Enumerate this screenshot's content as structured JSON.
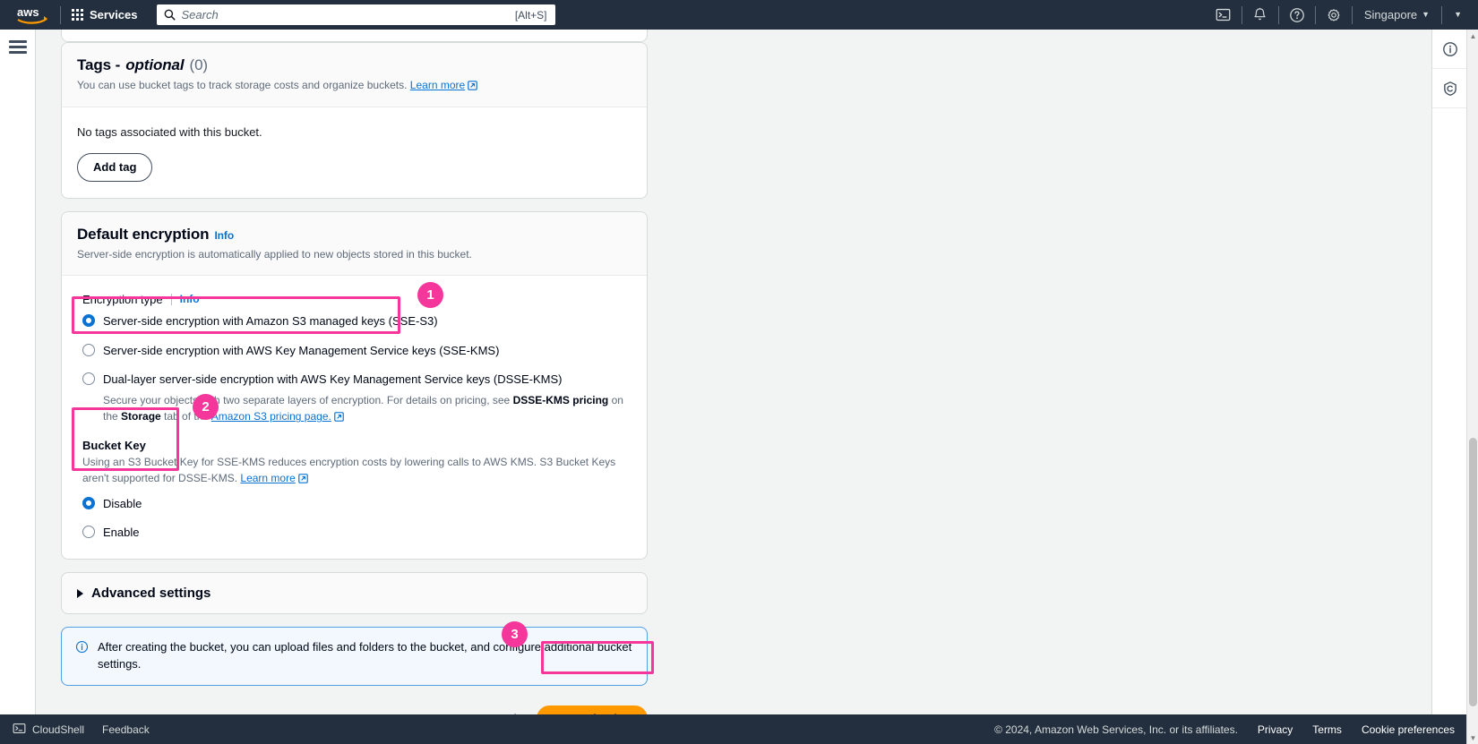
{
  "topnav": {
    "logo_icon": "aws-logo",
    "services_label": "Services",
    "services_icon": "grid-icon",
    "search": {
      "icon": "search-icon",
      "placeholder": "Search",
      "shortcut": "[Alt+S]",
      "value": ""
    },
    "icons": {
      "cloudshell": "terminal-icon",
      "notifications": "bell-icon",
      "help": "question-circle-icon",
      "settings": "gear-icon",
      "account_caret": "caret-down-icon"
    },
    "region_label": "Singapore",
    "region_caret": "▼"
  },
  "leftrail": {
    "menu_icon": "hamburger-menu-icon"
  },
  "rightrail": {
    "items": [
      {
        "icon": "info-circle-icon",
        "name": "help-panel-toggle"
      },
      {
        "icon": "shield-privacy-icon",
        "name": "privacy-panel-toggle"
      }
    ]
  },
  "tags_card": {
    "title": "Tags - ",
    "title_em": "optional",
    "count": "(0)",
    "description": "You can use bucket tags to track storage costs and organize buckets.",
    "learn_more": "Learn more",
    "empty_text": "No tags associated with this bucket.",
    "add_tag_label": "Add tag"
  },
  "encryption_card": {
    "title": "Default encryption",
    "info_label": "Info",
    "description": "Server-side encryption is automatically applied to new objects stored in this bucket.",
    "encryption_type_label": "Encryption type",
    "encryption_type_info": "Info",
    "options": [
      {
        "label": "Server-side encryption with Amazon S3 managed keys (SSE-S3)",
        "selected": true,
        "sub": ""
      },
      {
        "label": "Server-side encryption with AWS Key Management Service keys (SSE-KMS)",
        "selected": false,
        "sub": ""
      },
      {
        "label": "Dual-layer server-side encryption with AWS Key Management Service keys (DSSE-KMS)",
        "selected": false,
        "sub": "Secure your objects with two separate layers of encryption. For details on pricing, see DSSE-KMS pricing on the Storage tab of the ",
        "sub_link": "Amazon S3 pricing page."
      }
    ],
    "bucket_key": {
      "title": "Bucket Key",
      "description": "Using an S3 Bucket Key for SSE-KMS reduces encryption costs by lowering calls to AWS KMS. S3 Bucket Keys aren't supported for DSSE-KMS.",
      "learn_more": "Learn more",
      "options": [
        {
          "label": "Disable",
          "selected": true
        },
        {
          "label": "Enable",
          "selected": false
        }
      ]
    }
  },
  "advanced": {
    "title": "Advanced settings",
    "expand_icon": "triangle-right-icon",
    "expanded": false
  },
  "alert": {
    "icon": "info-circle-icon",
    "text": "After creating the bucket, you can upload files and folders to the bucket, and configure additional bucket settings."
  },
  "actions": {
    "cancel_label": "Cancel",
    "create_label": "Create bucket"
  },
  "footer": {
    "cloudshell_label": "CloudShell",
    "cloudshell_icon": "terminal-icon",
    "feedback_label": "Feedback",
    "copyright": "© 2024, Amazon Web Services, Inc. or its affiliates.",
    "links": [
      "Privacy",
      "Terms",
      "Cookie preferences"
    ]
  },
  "annotations": {
    "badges": [
      {
        "number": "1",
        "target": "encryption-type-group"
      },
      {
        "number": "2",
        "target": "bucket-key-group"
      },
      {
        "number": "3",
        "target": "create-bucket-button"
      }
    ],
    "highlight_color": "#f5369b"
  },
  "colors": {
    "nav_bg": "#232f3e",
    "page_bg": "#f2f3f3",
    "link": "#0972d3",
    "primary_button": "#ff9900",
    "annotation": "#f5369b"
  }
}
